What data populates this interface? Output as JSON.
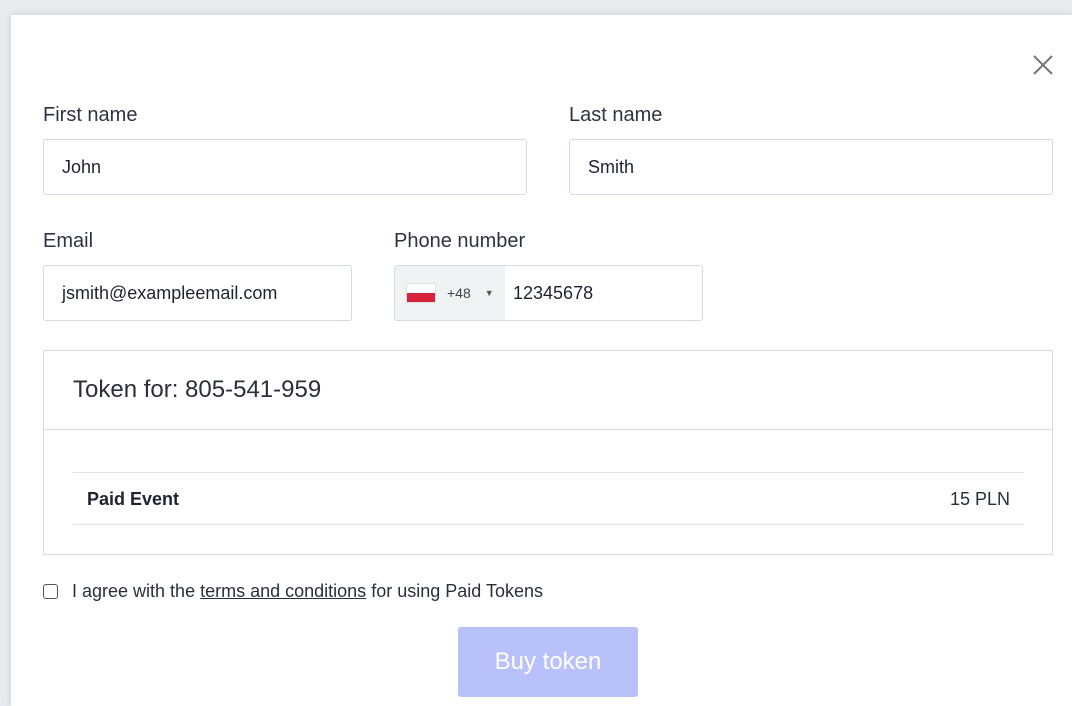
{
  "form": {
    "first_name_label": "First name",
    "first_name_value": "John",
    "last_name_label": "Last name",
    "last_name_value": "Smith",
    "email_label": "Email",
    "email_value": "jsmith@exampleemail.com",
    "phone_label": "Phone number",
    "phone_dial_code": "+48",
    "phone_country_flag": "poland-flag-icon",
    "phone_value": "12345678"
  },
  "token": {
    "title": "Token for: 805-541-959",
    "item_name": "Paid Event",
    "item_price": "15 PLN"
  },
  "agreement": {
    "prefix": "I agree with the",
    "link_text": "terms and conditions",
    "suffix": "for using Paid Tokens",
    "checked": false
  },
  "actions": {
    "buy_label": "Buy token"
  },
  "colors": {
    "buy_button_bg": "#b9c1fb",
    "field_border": "#d6d9e8",
    "flag_red": "#d8213a"
  },
  "icons": {
    "close": "close-icon",
    "dropdown": "caret-down-icon"
  }
}
